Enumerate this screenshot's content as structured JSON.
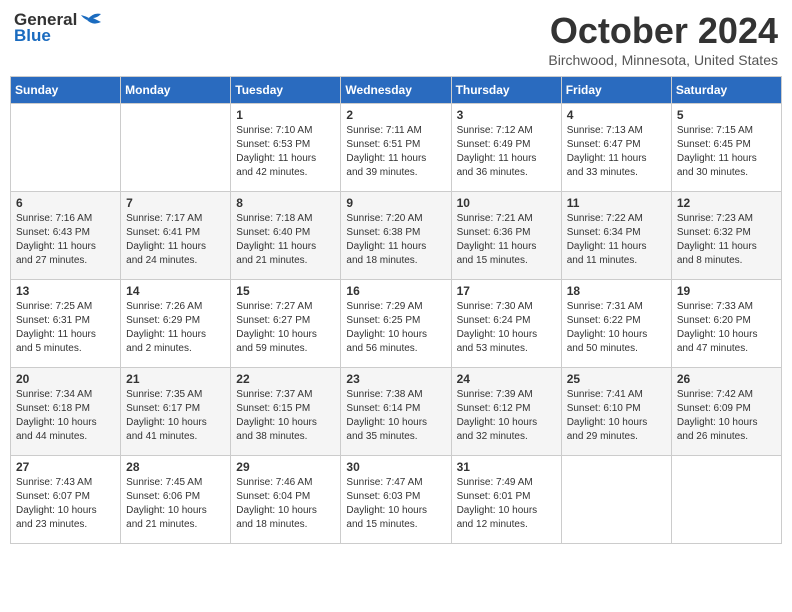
{
  "header": {
    "logo_general": "General",
    "logo_blue": "Blue",
    "title": "October 2024",
    "subtitle": "Birchwood, Minnesota, United States"
  },
  "days_of_week": [
    "Sunday",
    "Monday",
    "Tuesday",
    "Wednesday",
    "Thursday",
    "Friday",
    "Saturday"
  ],
  "weeks": [
    [
      {
        "day": "",
        "sunrise": "",
        "sunset": "",
        "daylight": ""
      },
      {
        "day": "",
        "sunrise": "",
        "sunset": "",
        "daylight": ""
      },
      {
        "day": "1",
        "sunrise": "Sunrise: 7:10 AM",
        "sunset": "Sunset: 6:53 PM",
        "daylight": "Daylight: 11 hours and 42 minutes."
      },
      {
        "day": "2",
        "sunrise": "Sunrise: 7:11 AM",
        "sunset": "Sunset: 6:51 PM",
        "daylight": "Daylight: 11 hours and 39 minutes."
      },
      {
        "day": "3",
        "sunrise": "Sunrise: 7:12 AM",
        "sunset": "Sunset: 6:49 PM",
        "daylight": "Daylight: 11 hours and 36 minutes."
      },
      {
        "day": "4",
        "sunrise": "Sunrise: 7:13 AM",
        "sunset": "Sunset: 6:47 PM",
        "daylight": "Daylight: 11 hours and 33 minutes."
      },
      {
        "day": "5",
        "sunrise": "Sunrise: 7:15 AM",
        "sunset": "Sunset: 6:45 PM",
        "daylight": "Daylight: 11 hours and 30 minutes."
      }
    ],
    [
      {
        "day": "6",
        "sunrise": "Sunrise: 7:16 AM",
        "sunset": "Sunset: 6:43 PM",
        "daylight": "Daylight: 11 hours and 27 minutes."
      },
      {
        "day": "7",
        "sunrise": "Sunrise: 7:17 AM",
        "sunset": "Sunset: 6:41 PM",
        "daylight": "Daylight: 11 hours and 24 minutes."
      },
      {
        "day": "8",
        "sunrise": "Sunrise: 7:18 AM",
        "sunset": "Sunset: 6:40 PM",
        "daylight": "Daylight: 11 hours and 21 minutes."
      },
      {
        "day": "9",
        "sunrise": "Sunrise: 7:20 AM",
        "sunset": "Sunset: 6:38 PM",
        "daylight": "Daylight: 11 hours and 18 minutes."
      },
      {
        "day": "10",
        "sunrise": "Sunrise: 7:21 AM",
        "sunset": "Sunset: 6:36 PM",
        "daylight": "Daylight: 11 hours and 15 minutes."
      },
      {
        "day": "11",
        "sunrise": "Sunrise: 7:22 AM",
        "sunset": "Sunset: 6:34 PM",
        "daylight": "Daylight: 11 hours and 11 minutes."
      },
      {
        "day": "12",
        "sunrise": "Sunrise: 7:23 AM",
        "sunset": "Sunset: 6:32 PM",
        "daylight": "Daylight: 11 hours and 8 minutes."
      }
    ],
    [
      {
        "day": "13",
        "sunrise": "Sunrise: 7:25 AM",
        "sunset": "Sunset: 6:31 PM",
        "daylight": "Daylight: 11 hours and 5 minutes."
      },
      {
        "day": "14",
        "sunrise": "Sunrise: 7:26 AM",
        "sunset": "Sunset: 6:29 PM",
        "daylight": "Daylight: 11 hours and 2 minutes."
      },
      {
        "day": "15",
        "sunrise": "Sunrise: 7:27 AM",
        "sunset": "Sunset: 6:27 PM",
        "daylight": "Daylight: 10 hours and 59 minutes."
      },
      {
        "day": "16",
        "sunrise": "Sunrise: 7:29 AM",
        "sunset": "Sunset: 6:25 PM",
        "daylight": "Daylight: 10 hours and 56 minutes."
      },
      {
        "day": "17",
        "sunrise": "Sunrise: 7:30 AM",
        "sunset": "Sunset: 6:24 PM",
        "daylight": "Daylight: 10 hours and 53 minutes."
      },
      {
        "day": "18",
        "sunrise": "Sunrise: 7:31 AM",
        "sunset": "Sunset: 6:22 PM",
        "daylight": "Daylight: 10 hours and 50 minutes."
      },
      {
        "day": "19",
        "sunrise": "Sunrise: 7:33 AM",
        "sunset": "Sunset: 6:20 PM",
        "daylight": "Daylight: 10 hours and 47 minutes."
      }
    ],
    [
      {
        "day": "20",
        "sunrise": "Sunrise: 7:34 AM",
        "sunset": "Sunset: 6:18 PM",
        "daylight": "Daylight: 10 hours and 44 minutes."
      },
      {
        "day": "21",
        "sunrise": "Sunrise: 7:35 AM",
        "sunset": "Sunset: 6:17 PM",
        "daylight": "Daylight: 10 hours and 41 minutes."
      },
      {
        "day": "22",
        "sunrise": "Sunrise: 7:37 AM",
        "sunset": "Sunset: 6:15 PM",
        "daylight": "Daylight: 10 hours and 38 minutes."
      },
      {
        "day": "23",
        "sunrise": "Sunrise: 7:38 AM",
        "sunset": "Sunset: 6:14 PM",
        "daylight": "Daylight: 10 hours and 35 minutes."
      },
      {
        "day": "24",
        "sunrise": "Sunrise: 7:39 AM",
        "sunset": "Sunset: 6:12 PM",
        "daylight": "Daylight: 10 hours and 32 minutes."
      },
      {
        "day": "25",
        "sunrise": "Sunrise: 7:41 AM",
        "sunset": "Sunset: 6:10 PM",
        "daylight": "Daylight: 10 hours and 29 minutes."
      },
      {
        "day": "26",
        "sunrise": "Sunrise: 7:42 AM",
        "sunset": "Sunset: 6:09 PM",
        "daylight": "Daylight: 10 hours and 26 minutes."
      }
    ],
    [
      {
        "day": "27",
        "sunrise": "Sunrise: 7:43 AM",
        "sunset": "Sunset: 6:07 PM",
        "daylight": "Daylight: 10 hours and 23 minutes."
      },
      {
        "day": "28",
        "sunrise": "Sunrise: 7:45 AM",
        "sunset": "Sunset: 6:06 PM",
        "daylight": "Daylight: 10 hours and 21 minutes."
      },
      {
        "day": "29",
        "sunrise": "Sunrise: 7:46 AM",
        "sunset": "Sunset: 6:04 PM",
        "daylight": "Daylight: 10 hours and 18 minutes."
      },
      {
        "day": "30",
        "sunrise": "Sunrise: 7:47 AM",
        "sunset": "Sunset: 6:03 PM",
        "daylight": "Daylight: 10 hours and 15 minutes."
      },
      {
        "day": "31",
        "sunrise": "Sunrise: 7:49 AM",
        "sunset": "Sunset: 6:01 PM",
        "daylight": "Daylight: 10 hours and 12 minutes."
      },
      {
        "day": "",
        "sunrise": "",
        "sunset": "",
        "daylight": ""
      },
      {
        "day": "",
        "sunrise": "",
        "sunset": "",
        "daylight": ""
      }
    ]
  ]
}
